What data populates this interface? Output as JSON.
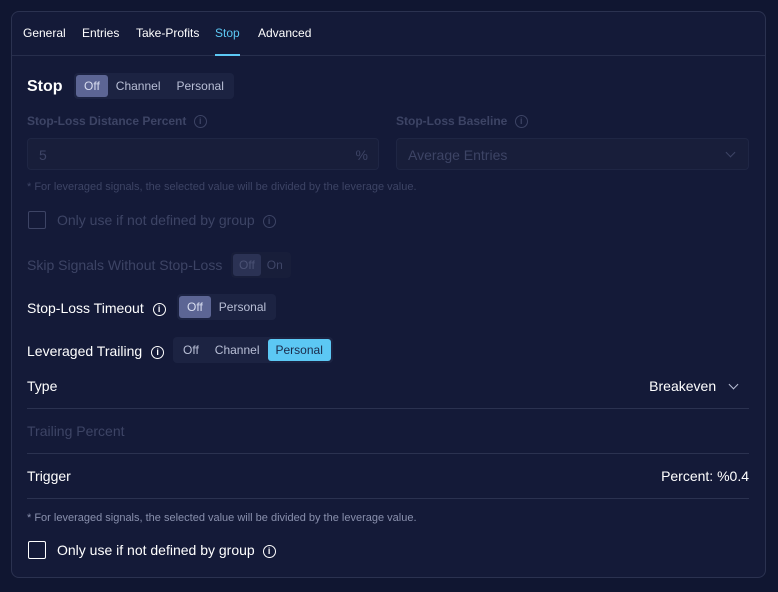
{
  "tabs": [
    {
      "label": "General"
    },
    {
      "label": "Entries"
    },
    {
      "label": "Take-Profits"
    },
    {
      "label": "Stop"
    },
    {
      "label": "Advanced"
    }
  ],
  "stop": {
    "title": "Stop",
    "options": [
      "Off",
      "Channel",
      "Personal"
    ],
    "selected": "Off"
  },
  "sl_distance": {
    "label": "Stop-Loss Distance Percent",
    "value": "5",
    "unit": "%"
  },
  "sl_baseline": {
    "label": "Stop-Loss Baseline",
    "value": "Average Entries"
  },
  "hint_top": "* For leveraged signals, the selected value will be divided by the leverage value.",
  "only_use_top": "Only use if not defined by group",
  "skip_signals": {
    "label": "Skip Signals Without Stop-Loss",
    "options": [
      "Off",
      "On"
    ],
    "selected": "Off"
  },
  "sl_timeout": {
    "label": "Stop-Loss Timeout",
    "options": [
      "Off",
      "Personal"
    ],
    "selected": "Off"
  },
  "lev_trailing": {
    "label": "Leveraged Trailing",
    "options": [
      "Off",
      "Channel",
      "Personal"
    ],
    "selected": "Personal"
  },
  "type": {
    "label": "Type",
    "value": "Breakeven"
  },
  "trailing_percent": {
    "label": "Trailing Percent"
  },
  "trigger": {
    "label": "Trigger",
    "value": "Percent: %0.4"
  },
  "hint_bottom": "* For leveraged signals, the selected value will be divided by the leverage value.",
  "only_use_bottom": "Only use if not defined by group",
  "colors": {
    "background": "#101631",
    "panel": "#141a38",
    "accent": "#5cc8f4",
    "selected_gray": "#5c6594"
  },
  "info_glyph": "i"
}
